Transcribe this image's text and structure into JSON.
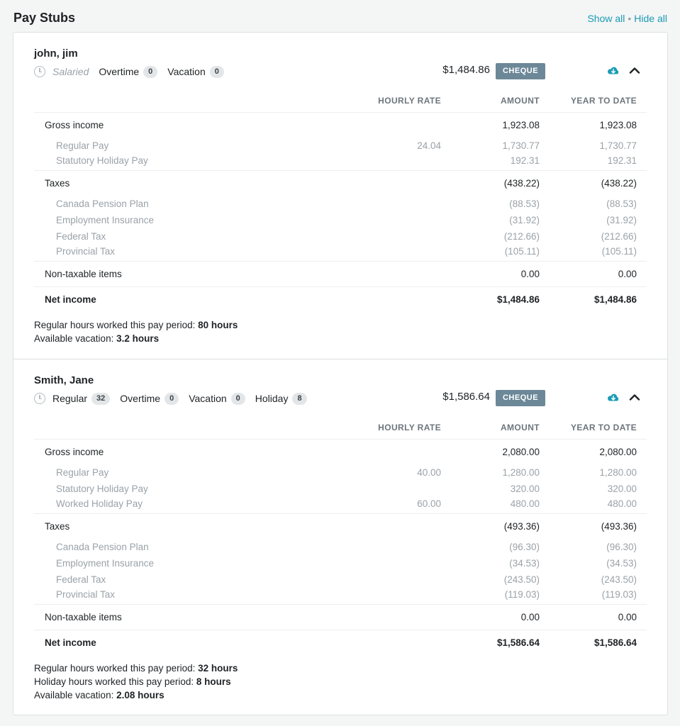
{
  "page": {
    "title": "Pay Stubs",
    "show_all": "Show all",
    "separator": "•",
    "hide_all": "Hide all"
  },
  "table_headers": {
    "hourly_rate": "HOURLY RATE",
    "amount": "AMOUNT",
    "year_to_date": "YEAR TO DATE"
  },
  "stubs": [
    {
      "name": "john, jim",
      "pay_type": "Salaried",
      "hours": [
        {
          "label": "Overtime",
          "count": "0"
        },
        {
          "label": "Vacation",
          "count": "0"
        }
      ],
      "net_amount": "$1,484.86",
      "pay_method": "CHEQUE",
      "gross": {
        "label": "Gross income",
        "amount": "1,923.08",
        "ytd": "1,923.08"
      },
      "gross_items": [
        {
          "label": "Regular Pay",
          "rate": "24.04",
          "amount": "1,730.77",
          "ytd": "1,730.77"
        },
        {
          "label": "Statutory Holiday Pay",
          "rate": "",
          "amount": "192.31",
          "ytd": "192.31"
        }
      ],
      "taxes": {
        "label": "Taxes",
        "amount": "(438.22)",
        "ytd": "(438.22)"
      },
      "tax_items": [
        {
          "label": "Canada Pension Plan",
          "amount": "(88.53)",
          "ytd": "(88.53)"
        },
        {
          "label": "Employment Insurance",
          "amount": "(31.92)",
          "ytd": "(31.92)"
        },
        {
          "label": "Federal Tax",
          "amount": "(212.66)",
          "ytd": "(212.66)"
        },
        {
          "label": "Provincial Tax",
          "amount": "(105.11)",
          "ytd": "(105.11)"
        }
      ],
      "non_taxable": {
        "label": "Non-taxable items",
        "amount": "0.00",
        "ytd": "0.00"
      },
      "net": {
        "label": "Net income",
        "amount": "$1,484.86",
        "ytd": "$1,484.86"
      },
      "summary": [
        {
          "label": "Regular hours worked this pay period:",
          "value": "80 hours"
        },
        {
          "label": "Available vacation:",
          "value": "3.2 hours"
        }
      ]
    },
    {
      "name": "Smith, Jane",
      "hours": [
        {
          "label": "Regular",
          "count": "32"
        },
        {
          "label": "Overtime",
          "count": "0"
        },
        {
          "label": "Vacation",
          "count": "0"
        },
        {
          "label": "Holiday",
          "count": "8"
        }
      ],
      "net_amount": "$1,586.64",
      "pay_method": "CHEQUE",
      "gross": {
        "label": "Gross income",
        "amount": "2,080.00",
        "ytd": "2,080.00"
      },
      "gross_items": [
        {
          "label": "Regular Pay",
          "rate": "40.00",
          "amount": "1,280.00",
          "ytd": "1,280.00"
        },
        {
          "label": "Statutory Holiday Pay",
          "rate": "",
          "amount": "320.00",
          "ytd": "320.00"
        },
        {
          "label": "Worked Holiday Pay",
          "rate": "60.00",
          "amount": "480.00",
          "ytd": "480.00"
        }
      ],
      "taxes": {
        "label": "Taxes",
        "amount": "(493.36)",
        "ytd": "(493.36)"
      },
      "tax_items": [
        {
          "label": "Canada Pension Plan",
          "amount": "(96.30)",
          "ytd": "(96.30)"
        },
        {
          "label": "Employment Insurance",
          "amount": "(34.53)",
          "ytd": "(34.53)"
        },
        {
          "label": "Federal Tax",
          "amount": "(243.50)",
          "ytd": "(243.50)"
        },
        {
          "label": "Provincial Tax",
          "amount": "(119.03)",
          "ytd": "(119.03)"
        }
      ],
      "non_taxable": {
        "label": "Non-taxable items",
        "amount": "0.00",
        "ytd": "0.00"
      },
      "net": {
        "label": "Net income",
        "amount": "$1,586.64",
        "ytd": "$1,586.64"
      },
      "summary": [
        {
          "label": "Regular hours worked this pay period:",
          "value": "32 hours"
        },
        {
          "label": "Holiday hours worked this pay period:",
          "value": "8 hours"
        },
        {
          "label": "Available vacation:",
          "value": "2.08 hours"
        }
      ]
    }
  ],
  "icons": {
    "clock": "clock-icon",
    "download": "cloud-download-icon",
    "collapse": "chevron-up-icon",
    "download_color": "#1a9bb4"
  }
}
